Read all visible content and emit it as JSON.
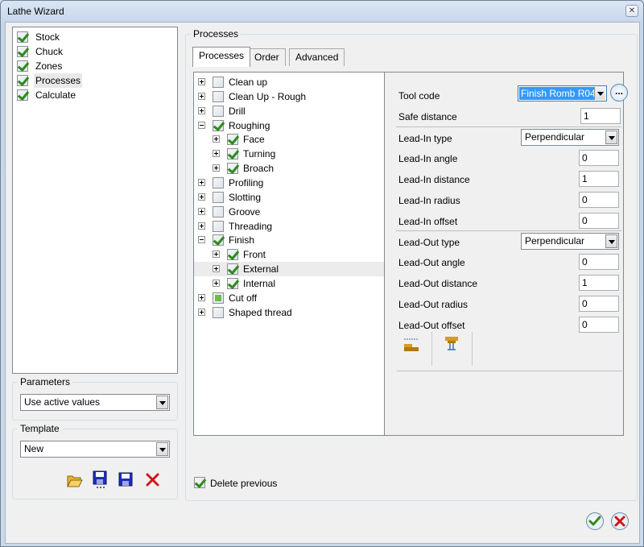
{
  "window": {
    "title": "Lathe Wizard",
    "close_label": "✕"
  },
  "steps": [
    {
      "label": "Stock",
      "checked": true
    },
    {
      "label": "Chuck",
      "checked": true
    },
    {
      "label": "Zones",
      "checked": true
    },
    {
      "label": "Processes",
      "checked": true,
      "selected": true
    },
    {
      "label": "Calculate",
      "checked": true
    }
  ],
  "parameters": {
    "legend": "Parameters",
    "value": "Use active values"
  },
  "template": {
    "legend": "Template",
    "value": "New"
  },
  "processes_group": {
    "legend": "Processes"
  },
  "tabs": [
    {
      "label": "Processes",
      "active": true
    },
    {
      "label": "Order"
    },
    {
      "label": "Advanced"
    }
  ],
  "tree": [
    {
      "label": "Clean up",
      "state": "none",
      "expanded": false
    },
    {
      "label": "Clean Up - Rough",
      "state": "none",
      "expanded": false
    },
    {
      "label": "Drill",
      "state": "none",
      "expanded": false
    },
    {
      "label": "Roughing",
      "state": "on",
      "expanded": true
    },
    {
      "label": "Face",
      "state": "on",
      "child": true
    },
    {
      "label": "Turning",
      "state": "on",
      "child": true
    },
    {
      "label": "Broach",
      "state": "on",
      "child": true
    },
    {
      "label": "Profiling",
      "state": "none",
      "expanded": false
    },
    {
      "label": "Slotting",
      "state": "none",
      "expanded": false
    },
    {
      "label": "Groove",
      "state": "none",
      "expanded": false
    },
    {
      "label": "Threading",
      "state": "none",
      "expanded": false
    },
    {
      "label": "Finish",
      "state": "on",
      "expanded": true
    },
    {
      "label": "Front",
      "state": "on",
      "child": true
    },
    {
      "label": "External",
      "state": "on",
      "child": true,
      "highlight": true
    },
    {
      "label": "Internal",
      "state": "on",
      "child": true
    },
    {
      "label": "Cut off",
      "state": "partial",
      "expanded": false
    },
    {
      "label": "Shaped thread",
      "state": "none",
      "expanded": false
    }
  ],
  "props": {
    "tool_code": {
      "label": "Tool code",
      "value": "Finish Romb R04",
      "more": "..."
    },
    "safe_distance": {
      "label": "Safe distance",
      "value": "1"
    },
    "leadin_type": {
      "label": "Lead-In type",
      "value": "Perpendicular"
    },
    "leadin_angle": {
      "label": "Lead-In angle",
      "value": "0"
    },
    "leadin_distance": {
      "label": "Lead-In distance",
      "value": "1"
    },
    "leadin_radius": {
      "label": "Lead-In radius",
      "value": "0"
    },
    "leadin_offset": {
      "label": "Lead-In offset",
      "value": "0"
    },
    "leadout_type": {
      "label": "Lead-Out type",
      "value": "Perpendicular"
    },
    "leadout_angle": {
      "label": "Lead-Out angle",
      "value": "0"
    },
    "leadout_distance": {
      "label": "Lead-Out distance",
      "value": "1"
    },
    "leadout_radius": {
      "label": "Lead-Out radius",
      "value": "0"
    },
    "leadout_offset": {
      "label": "Lead-Out offset",
      "value": "0"
    }
  },
  "delete_previous": {
    "label": "Delete previous",
    "checked": true
  },
  "colors": {
    "accent": "#3399ff",
    "check": "#2d8a1e",
    "ok": "#2e8b1e",
    "cancel": "#d0141a"
  }
}
